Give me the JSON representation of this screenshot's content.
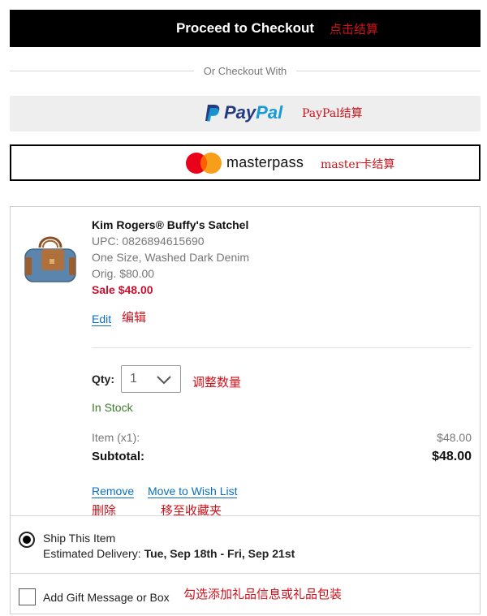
{
  "checkout": {
    "proceed_label": "Proceed to Checkout",
    "proceed_annotation": "点击结算",
    "or_label": "Or Checkout With",
    "paypal_pay": "Pay",
    "paypal_pal": "Pal",
    "paypal_annotation": "PayPal结算",
    "masterpass_label": "masterpass",
    "masterpass_annotation": "master卡结算"
  },
  "item": {
    "name": "Kim Rogers® Buffy's Satchel",
    "upc": "UPC: 0826894615690",
    "variant": "One Size, Washed Dark Denim",
    "orig_price": "Orig. $80.00",
    "sale_price": "Sale $48.00",
    "edit_label": "Edit",
    "edit_annotation": "编辑",
    "qty_label": "Qty:",
    "qty_value": "1",
    "qty_annotation": "调整数量",
    "stock": "In Stock",
    "item_count_label": "Item (x1):",
    "item_amount": "$48.00",
    "subtotal_label": "Subtotal:",
    "subtotal_amount": "$48.00",
    "remove_label": "Remove",
    "remove_annotation": "删除",
    "wishlist_label": "Move to Wish List",
    "wishlist_annotation": "移至收藏夹"
  },
  "shipping": {
    "option_label": "Ship This Item",
    "estimated_label": "Estimated Delivery:",
    "estimated_dates": "Tue, Sep 18th - Fri, Sep 21st"
  },
  "gift": {
    "label": "Add Gift Message or Box",
    "annotation": "勾选添加礼品信息或礼品包装"
  },
  "colors": {
    "annotation": "#d0121b",
    "sale": "#c8102e",
    "link": "#0b6fbd",
    "in_stock": "#3c7a2a",
    "paypal_dark": "#253b80",
    "paypal_light": "#179bd7"
  }
}
